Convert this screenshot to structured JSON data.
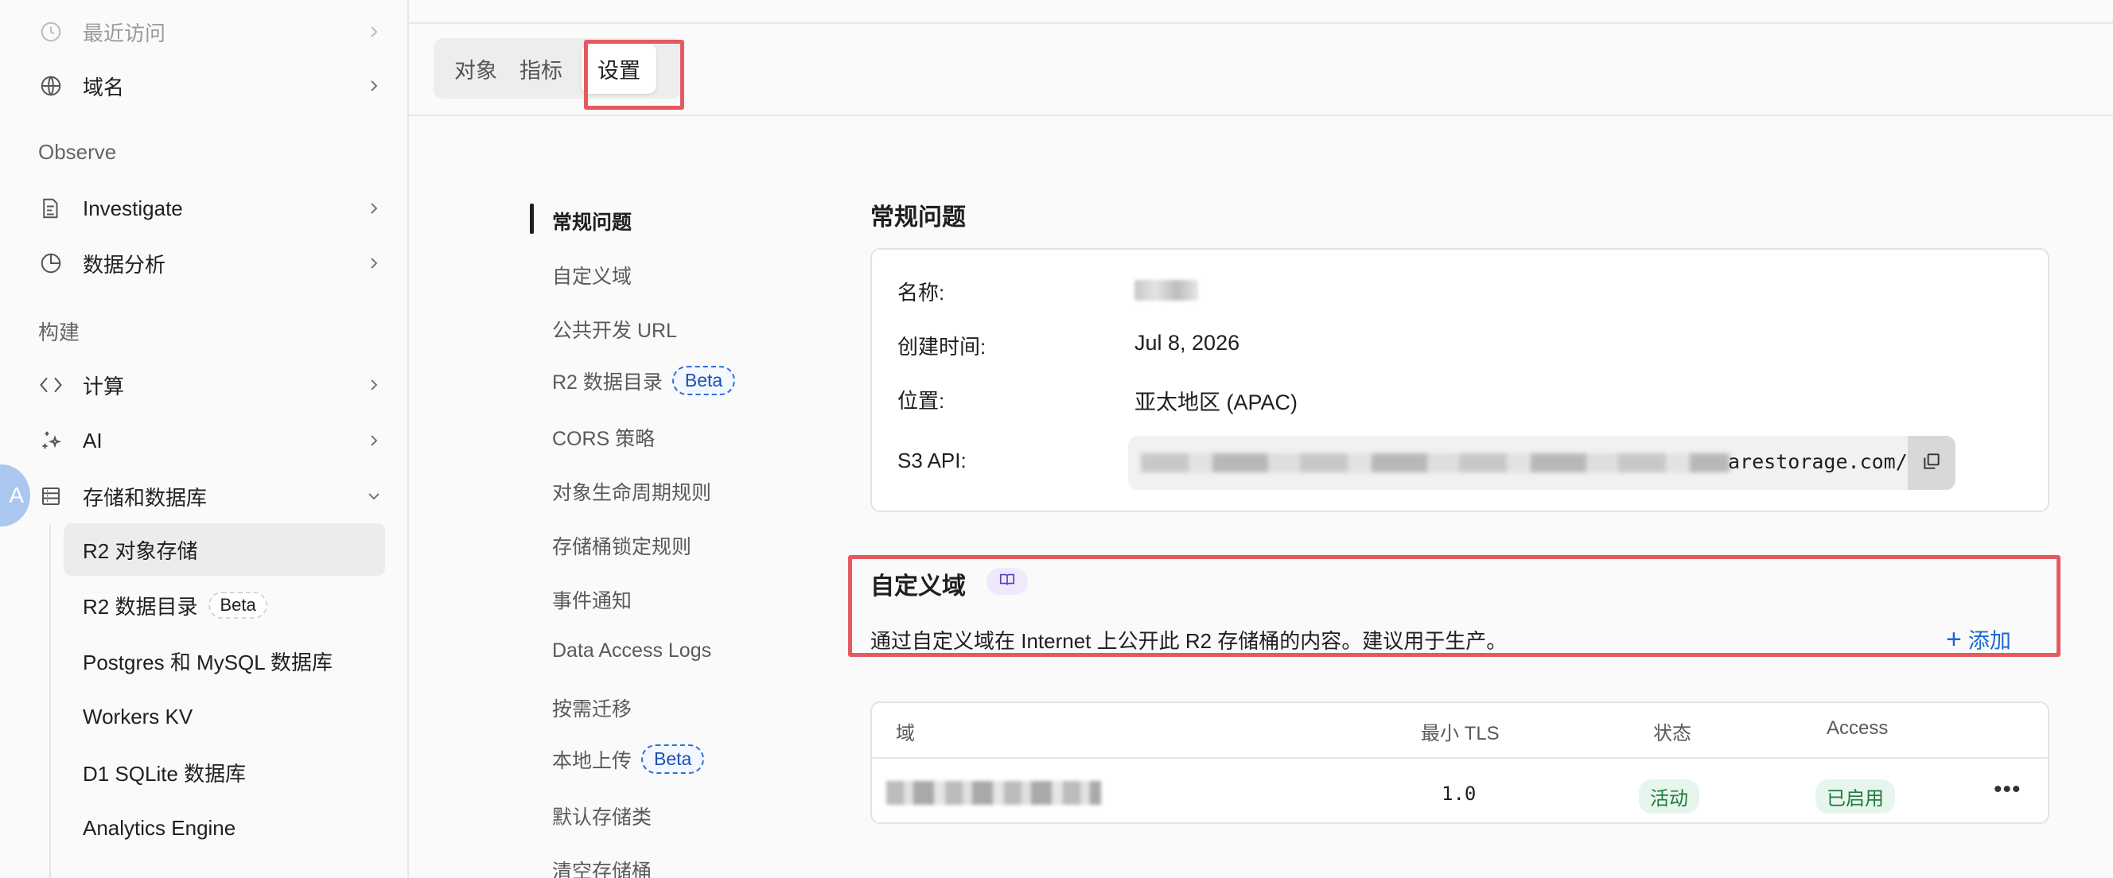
{
  "sidebar": {
    "recent_label": "最近访问",
    "domains_label": "域名",
    "observe_section": "Observe",
    "investigate_label": "Investigate",
    "analytics_label": "数据分析",
    "build_section": "构建",
    "compute_label": "计算",
    "ai_label": "AI",
    "storage_label": "存储和数据库",
    "sub_items": [
      {
        "label": "R2 对象存储"
      },
      {
        "label": "R2 数据目录",
        "badge": "Beta"
      },
      {
        "label": "Postgres 和 MySQL 数据库"
      },
      {
        "label": "Workers KV"
      },
      {
        "label": "D1 SQLite 数据库"
      },
      {
        "label": "Analytics Engine"
      }
    ],
    "avatar_letter": "A"
  },
  "tabs": [
    {
      "label": "对象"
    },
    {
      "label": "指标"
    },
    {
      "label": "设置"
    }
  ],
  "settings_nav": [
    {
      "label": "常规问题"
    },
    {
      "label": "自定义域"
    },
    {
      "label": "公共开发 URL"
    },
    {
      "label": "R2 数据目录",
      "badge": "Beta"
    },
    {
      "label": "CORS 策略"
    },
    {
      "label": "对象生命周期规则"
    },
    {
      "label": "存储桶锁定规则"
    },
    {
      "label": "事件通知"
    },
    {
      "label": "Data Access Logs"
    },
    {
      "label": "按需迁移"
    },
    {
      "label": "本地上传",
      "badge": "Beta"
    },
    {
      "label": "默认存储类"
    },
    {
      "label": "清空存储桶"
    }
  ],
  "general": {
    "title": "常规问题",
    "name_label": "名称:",
    "created_label": "创建时间:",
    "created_value": "Jul 8, 2026",
    "location_label": "位置:",
    "location_value": "亚太地区 (APAC)",
    "s3_label": "S3 API:",
    "s3_value_visible": "arestorage.com/i"
  },
  "custom_domain": {
    "title": "自定义域",
    "description": "通过自定义域在 Internet 上公开此 R2 存储桶的内容。建议用于生产。",
    "add_label": "添加",
    "columns": [
      "域",
      "最小 TLS",
      "状态",
      "Access"
    ],
    "rows": [
      {
        "tls": "1.0",
        "status": "活动",
        "access": "已启用"
      }
    ],
    "more_glyph": "•••"
  },
  "colors": {
    "highlight": "#e55a5f",
    "link_blue": "#1a66d2",
    "success_bg": "#e7f6ec",
    "success_text": "#1f7a3e"
  }
}
